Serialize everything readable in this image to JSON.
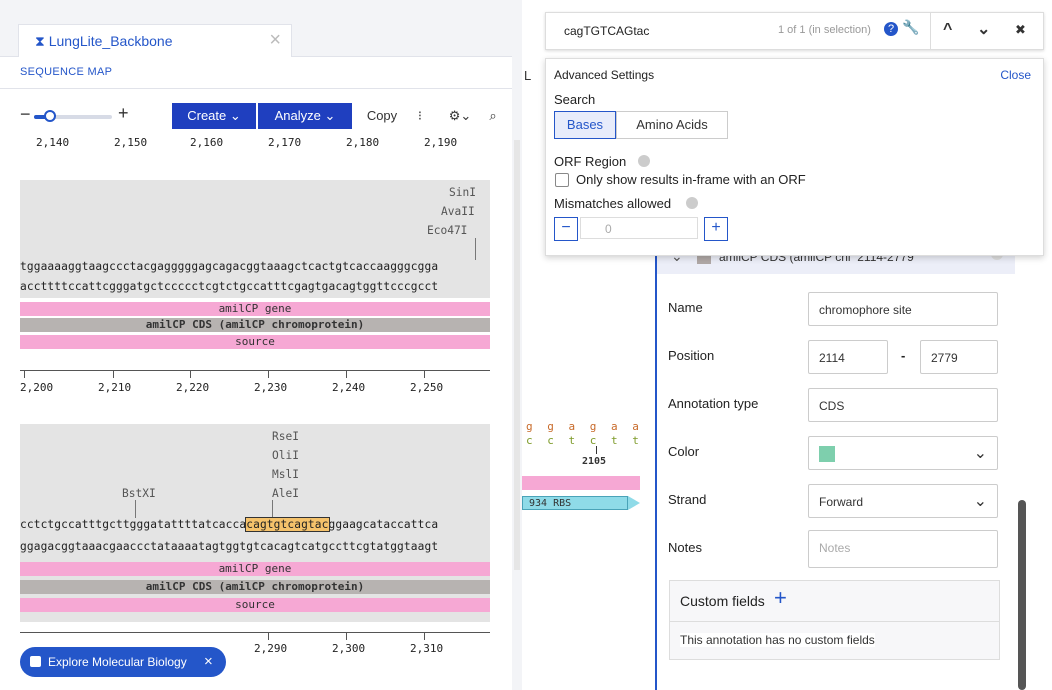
{
  "tab": {
    "title": "LungLite_Backbone",
    "close": "×"
  },
  "sequence_map_label": "SEQUENCE MAP",
  "toolbar": {
    "zoom_minus": "−",
    "zoom_plus": "+",
    "zoom_level": 0.2,
    "create": "Create ⌄",
    "analyze": "Analyze ⌄",
    "copy": "Copy",
    "more": "⁝",
    "gear": "⚙⌄",
    "search": "⌕"
  },
  "ruler_top": [
    "2,140",
    "2,150",
    "2,160",
    "2,170",
    "2,180",
    "2,190"
  ],
  "block1": {
    "enzymes": [
      "SinI",
      "AvaII",
      "Eco47I"
    ],
    "seq_top": "tggaaaaggtaagccctacgagggggagcagacggtaaagctcactgtcaccaagggcgga",
    "seq_bottom": "accttttccattcgggatgctccccctcgtctgccatttcgagtgacagtggttcccgcct",
    "features": [
      "amilCP gene",
      "amilCP CDS (amilCP chromoprotein)",
      "source"
    ],
    "ruler": [
      "2,200",
      "2,210",
      "2,220",
      "2,230",
      "2,240",
      "2,250"
    ]
  },
  "block2": {
    "enzymes": [
      "RseI",
      "OliI",
      "MslI",
      "AleI"
    ],
    "enzyme_left": "BstXI",
    "seq_top_a": "cctctgccatttgcttgggatattttatcacca",
    "seq_top_hl": "cagtgtcagtac",
    "seq_top_b": "ggaagcataccattca",
    "seq_bottom": "ggagacggtaaacgaaccctataaaatagtggtgtcacagtcatgccttcgtatggtaagt",
    "features": [
      "amilCP gene",
      "amilCP CDS (amilCP chromoprotein)",
      "source"
    ],
    "ruler": [
      "2,290",
      "2,300",
      "2,310"
    ]
  },
  "middle": {
    "top_nt": "g g a g a a a t",
    "bottom_nt": "c c t c t t t a",
    "position": "2105",
    "rbs_label": "934 RBS",
    "side_letter": "L"
  },
  "search": {
    "query": "cagTGTCAGtac",
    "match_count": "1 of 1 (in selection)",
    "up": "^",
    "down": "⌄",
    "close": "✖"
  },
  "advanced": {
    "title": "Advanced Settings",
    "close": "Close",
    "search_label": "Search",
    "bases": "Bases",
    "amino_acids": "Amino Acids",
    "orf_label": "ORF Region",
    "orf_check": "Only show results in-frame with an ORF",
    "mismatch_label": "Mismatches allowed",
    "mismatch_value": "0",
    "minus": "−",
    "plus": "+"
  },
  "annotation": {
    "header": "amilCP CDS (amilCP chi  2114-2779",
    "name_label": "Name",
    "name_value": "chromophore site",
    "position_label": "Position",
    "pos_start": "2114",
    "pos_sep": "-",
    "pos_end": "2779",
    "type_label": "Annotation type",
    "type_value": "CDS",
    "color_label": "Color",
    "color_value": "#7ecfad",
    "strand_label": "Strand",
    "strand_value": "Forward",
    "notes_label": "Notes",
    "notes_placeholder": "Notes",
    "custom_fields": "Custom fields",
    "custom_plus": "+",
    "no_custom": "This annotation has no custom fields"
  },
  "explore": {
    "label": "Explore Molecular Biology",
    "close": "×"
  },
  "colors": {
    "accent": "#2456c9",
    "feature_pink": "#f6a8d4",
    "feature_grey": "#b7b3b1",
    "highlight": "#f5c26b"
  }
}
